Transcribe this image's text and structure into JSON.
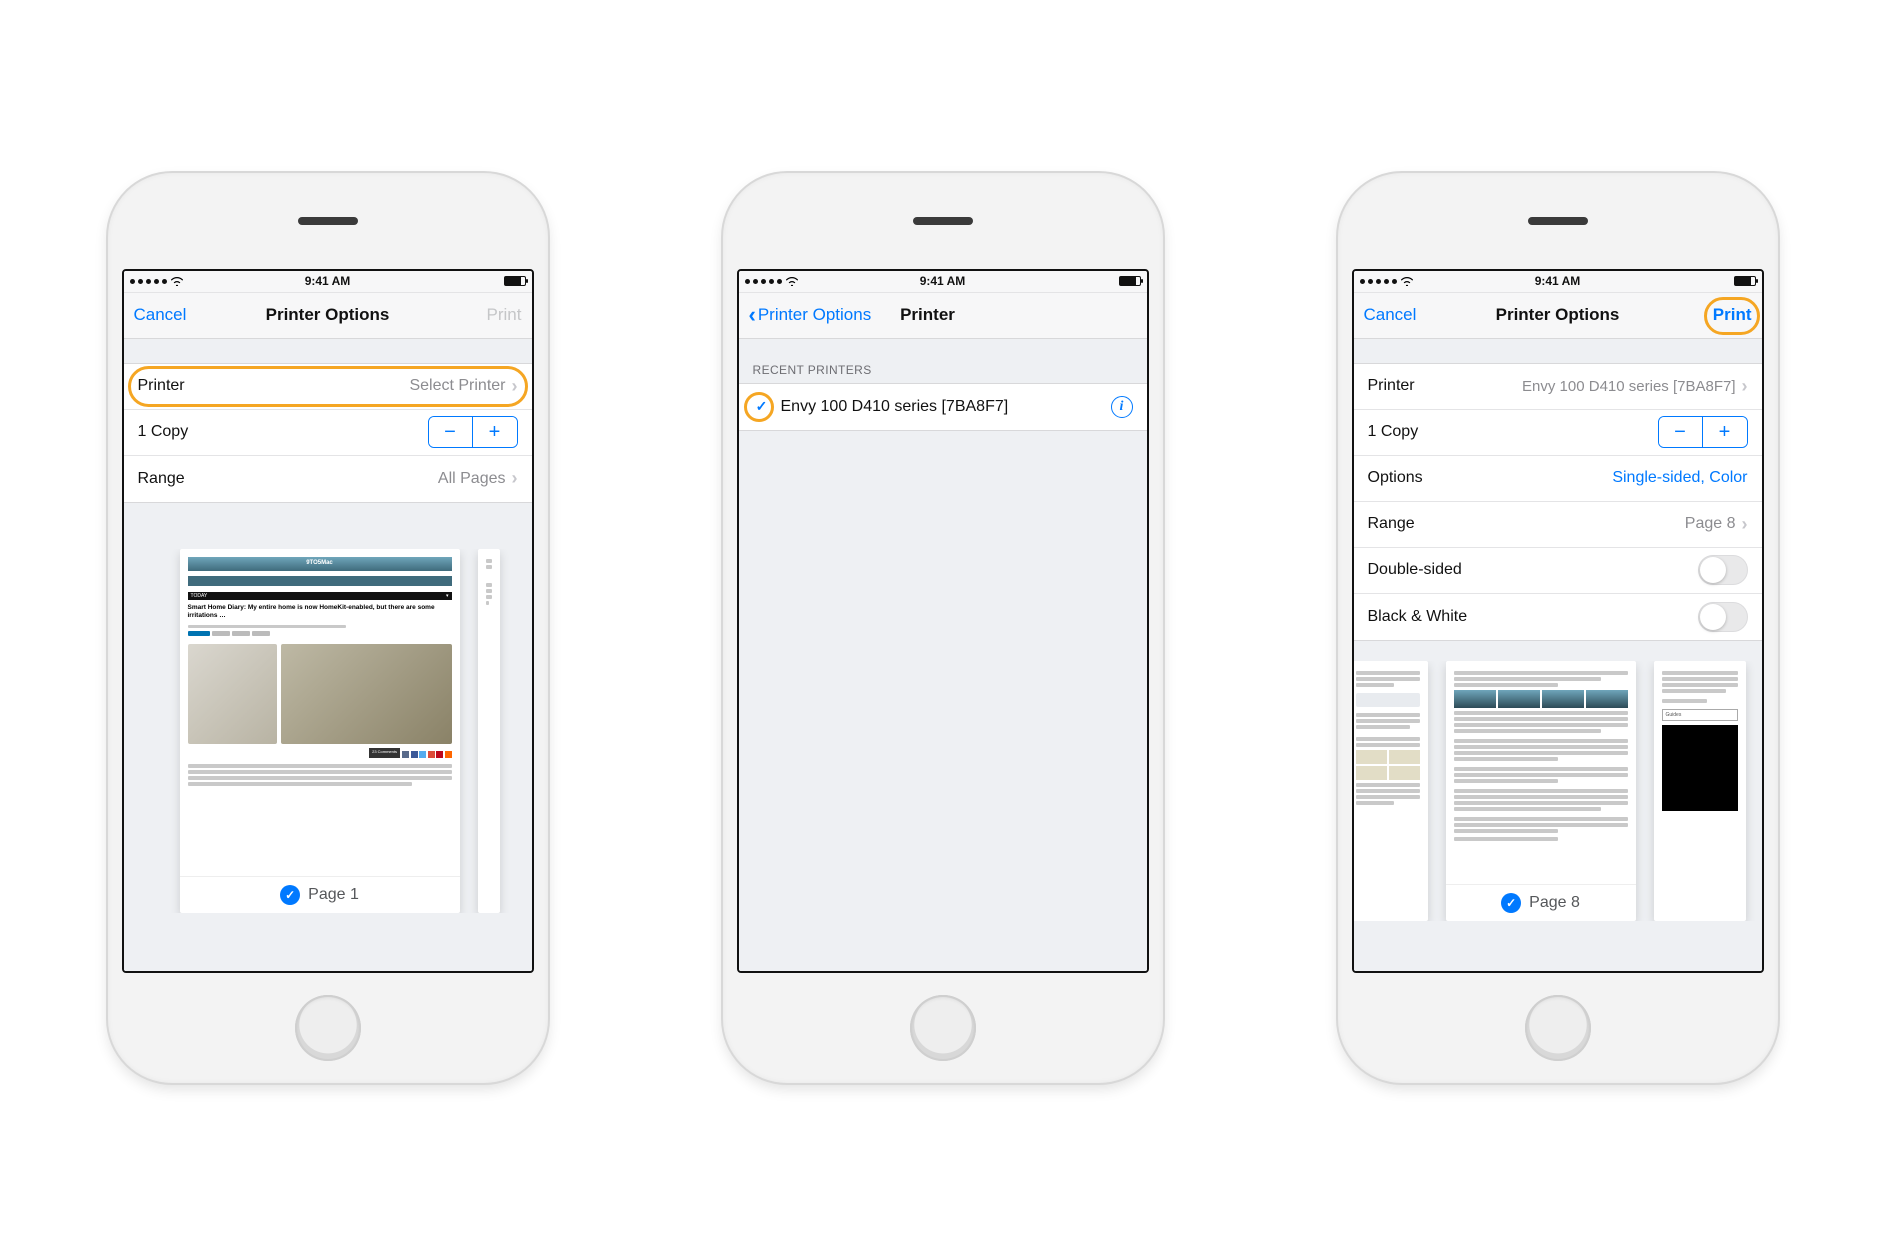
{
  "status": {
    "time": "9:41 AM"
  },
  "p1": {
    "nav": {
      "cancel": "Cancel",
      "title": "Printer Options",
      "print": "Print"
    },
    "rows": {
      "printer_label": "Printer",
      "printer_value": "Select Printer",
      "copies_label": "1 Copy",
      "range_label": "Range",
      "range_value": "All Pages"
    },
    "preview": {
      "site_name": "9TO5Mac",
      "today": "TODAY",
      "headline": "Smart Home Diary: My entire home is now HomeKit-enabled, but there are some irritations …",
      "page_label": "Page 1"
    }
  },
  "p2": {
    "nav": {
      "back": "Printer Options",
      "title": "Printer"
    },
    "section": "RECENT PRINTERS",
    "printer_name": "Envy 100 D410 series [7BA8F7]"
  },
  "p3": {
    "nav": {
      "cancel": "Cancel",
      "title": "Printer Options",
      "print": "Print"
    },
    "rows": {
      "printer_label": "Printer",
      "printer_value": "Envy 100 D410 series [7BA8F7]",
      "copies_label": "1 Copy",
      "options_label": "Options",
      "options_value": "Single-sided, Color",
      "range_label": "Range",
      "range_value": "Page 8",
      "double_label": "Double-sided",
      "bw_label": "Black & White"
    },
    "preview": {
      "page_label": "Page 8",
      "guides": "Guides"
    }
  }
}
